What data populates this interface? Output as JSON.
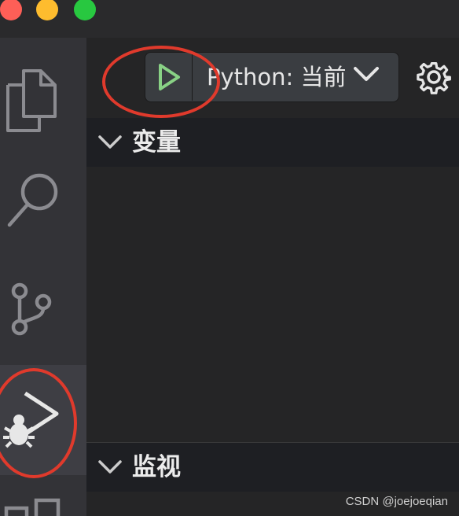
{
  "window": {
    "traffic_lights": {
      "close_color": "#fe5f57",
      "minimize_color": "#febc2e",
      "maximize_color": "#28c840"
    }
  },
  "activity_bar": {
    "items": [
      {
        "icon": "files-icon",
        "active": false
      },
      {
        "icon": "search-icon",
        "active": false
      },
      {
        "icon": "source-control-icon",
        "active": false
      },
      {
        "icon": "run-debug-icon",
        "active": true
      },
      {
        "icon": "extensions-icon",
        "active": false
      }
    ]
  },
  "debug_toolbar": {
    "start_icon": "play-icon",
    "start_icon_color": "#89d185",
    "configuration_label": "Python: 当前",
    "dropdown_icon": "chevron-down-icon",
    "settings_icon": "gear-icon"
  },
  "sections": {
    "variables": {
      "title": "变量",
      "expanded": true
    },
    "watch": {
      "title": "监视",
      "expanded": true
    }
  },
  "annotations": {
    "highlight_color": "#e03a2c"
  },
  "watermark": "CSDN @joejoeqian"
}
